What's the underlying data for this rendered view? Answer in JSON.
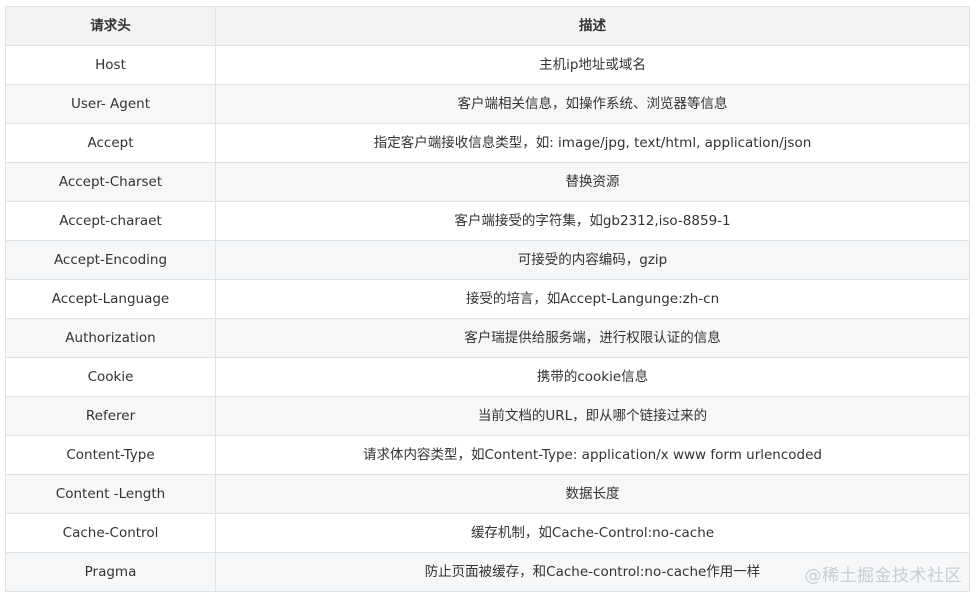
{
  "table": {
    "headers": [
      "请求头",
      "描述"
    ],
    "rows": [
      [
        "Host",
        "主机ip地址或域名"
      ],
      [
        "User- Agent",
        "客户端相关信息，如操作系统、浏览器等信息"
      ],
      [
        "Accept",
        "指定客户端接收信息类型，如: image/jpg, text/html, application/json"
      ],
      [
        "Accept-Charset",
        "替换资源"
      ],
      [
        "Accept-charaet",
        "客户端接受的字符集，如gb2312,iso-8859-1"
      ],
      [
        "Accept-Encoding",
        "可接受的内容编码，gzip"
      ],
      [
        "Accept-Language",
        "接受的培言，如Accept-Langunge:zh-cn"
      ],
      [
        "Authorization",
        "客户瑞提供给服务端，进行权限认证的信息"
      ],
      [
        "Cookie",
        "携带的cookie信息"
      ],
      [
        "Referer",
        "当前文档的URL，即从哪个链接过来的"
      ],
      [
        "Content-Type",
        "请求体内容类型，如Content-Type: application/x www form urlencoded"
      ],
      [
        "Content -Length",
        "数据长度"
      ],
      [
        "Cache-Control",
        "缓存机制，如Cache-Control:no-cache"
      ],
      [
        "Pragma",
        "防止页面被缓存，和Cache-control:no-cache作用一样"
      ]
    ]
  },
  "watermark": "@稀土掘金技术社区"
}
